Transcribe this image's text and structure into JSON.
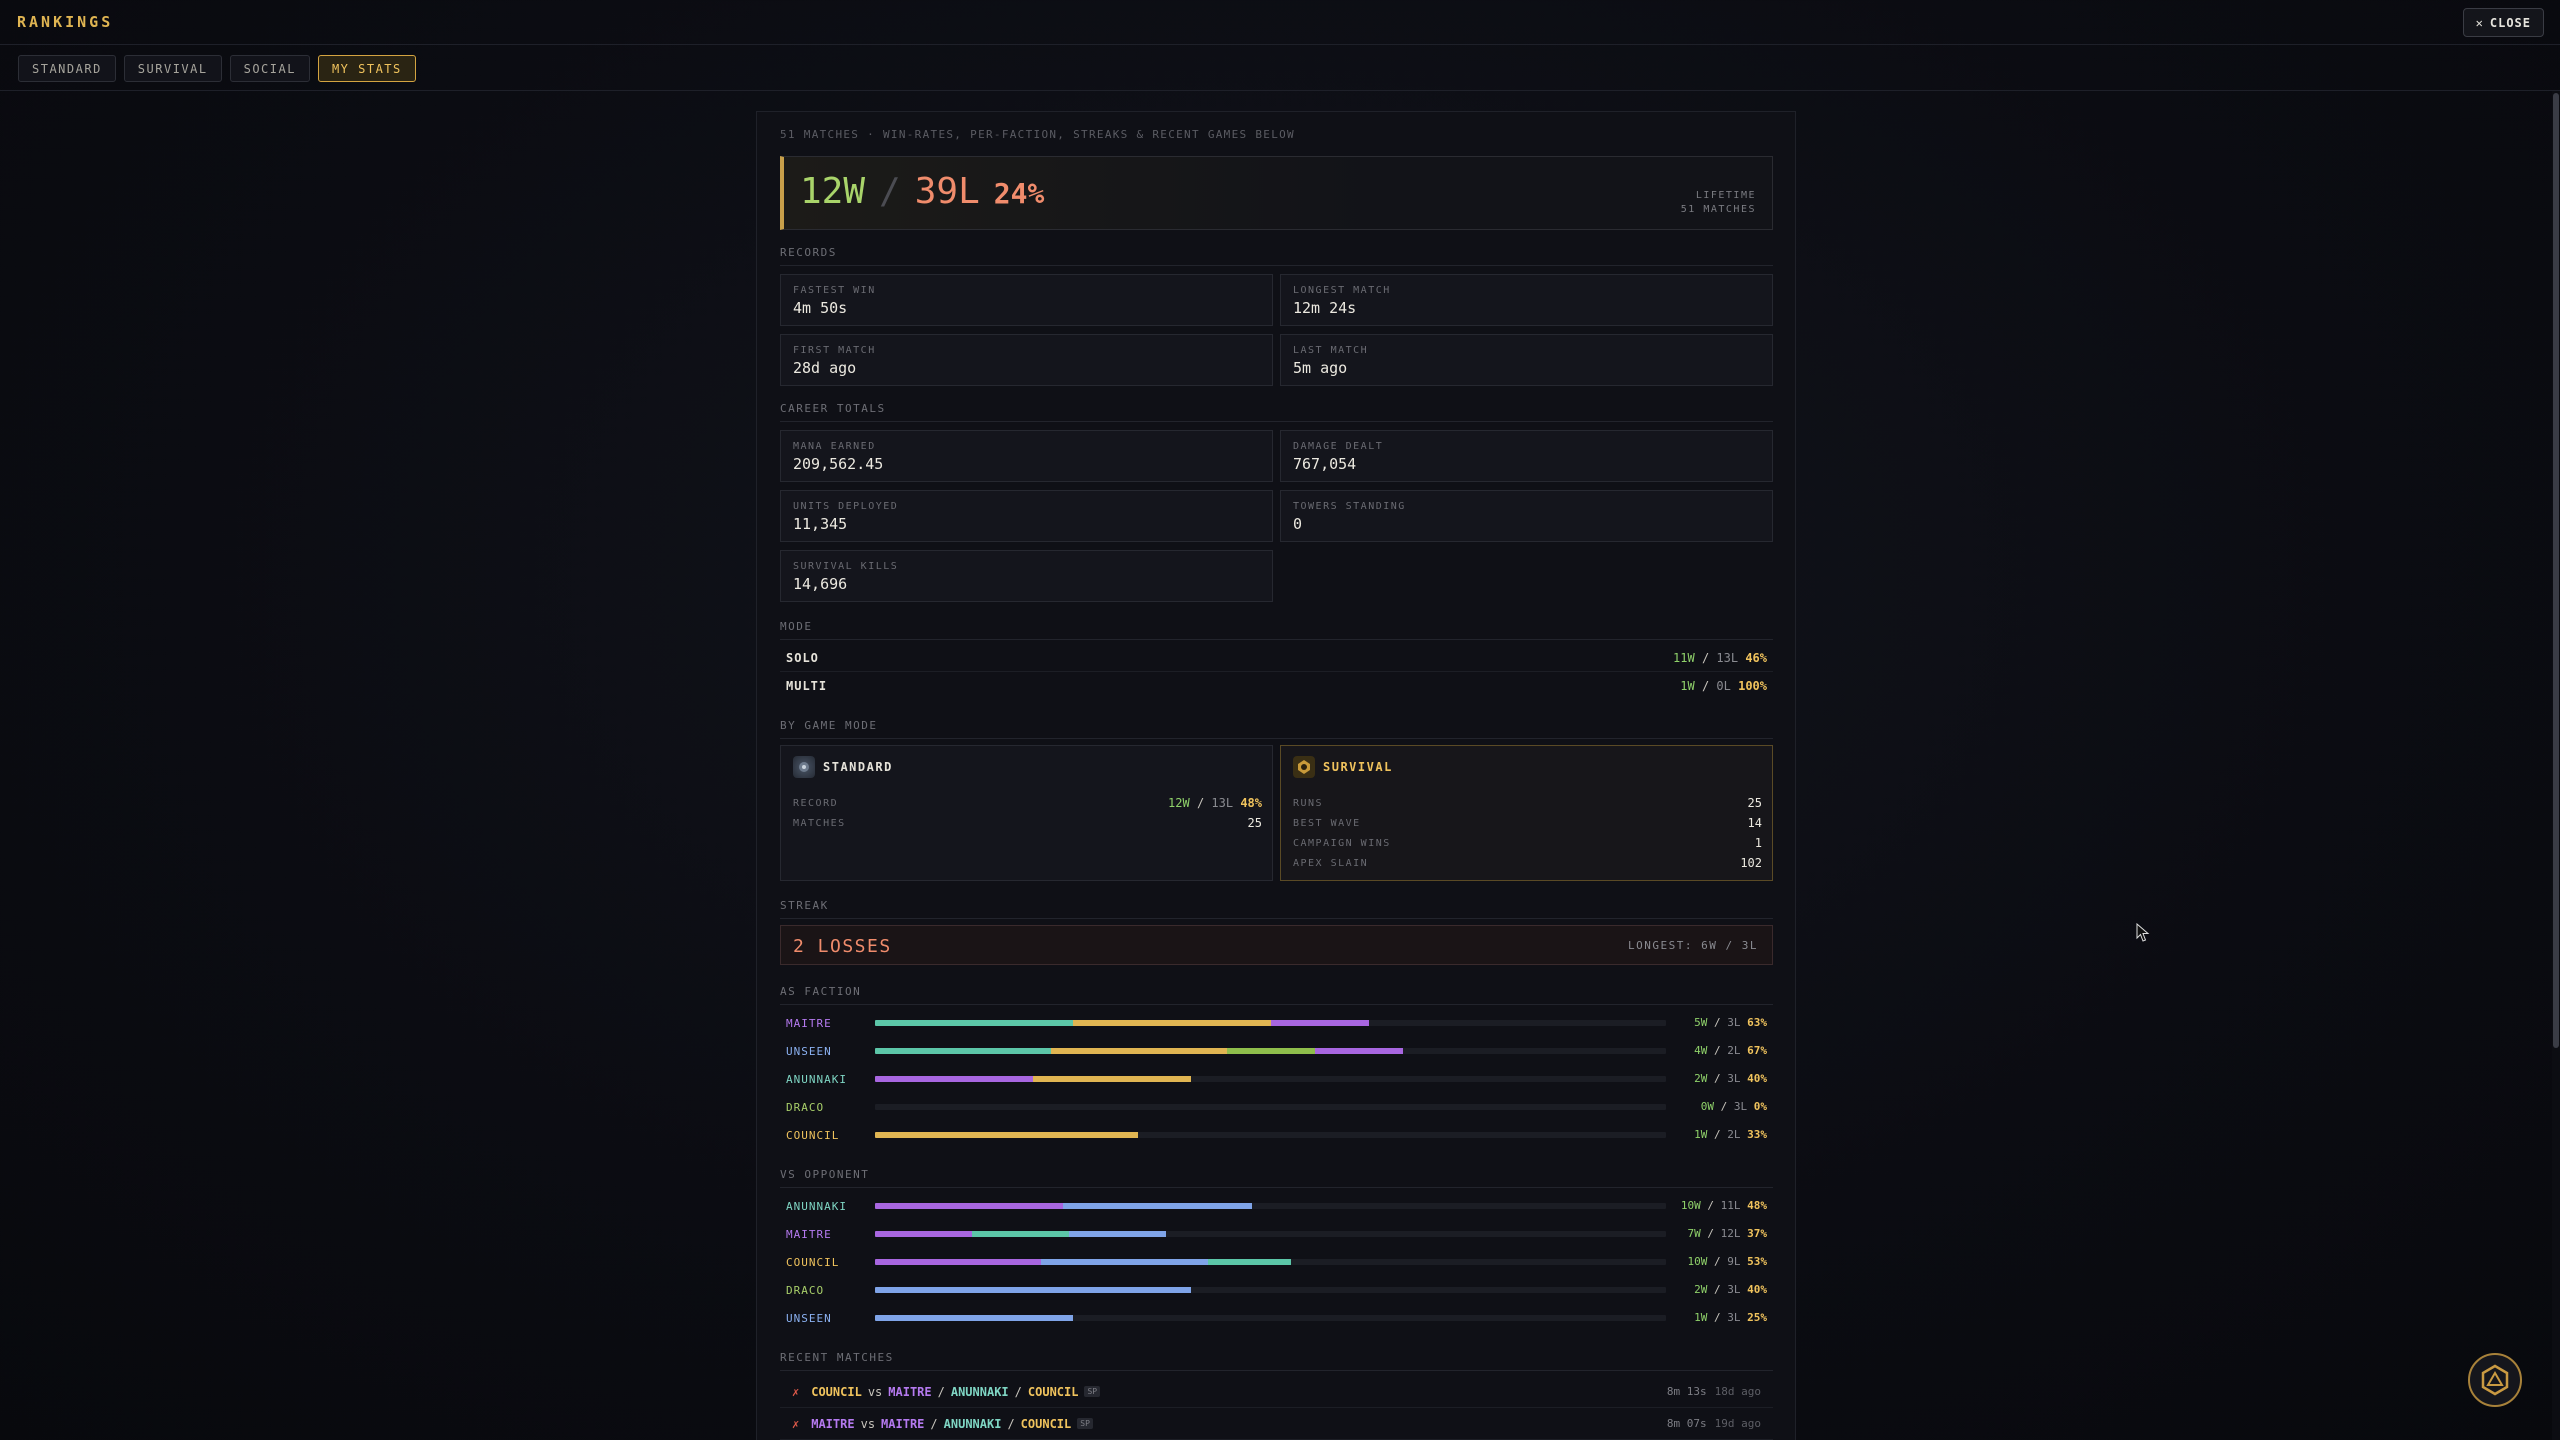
{
  "header": {
    "title": "RANKINGS",
    "close_label": "CLOSE"
  },
  "tabs": [
    {
      "label": "STANDARD",
      "active": false
    },
    {
      "label": "SURVIVAL",
      "active": false
    },
    {
      "label": "SOCIAL",
      "active": false
    },
    {
      "label": "MY STATS",
      "active": true
    }
  ],
  "summary": {
    "subtitle": "51 MATCHES · WIN-RATES, PER-FACTION, STREAKS & RECENT GAMES BELOW",
    "wins": "12W",
    "slash": "/",
    "losses": "39L",
    "pct": "24%",
    "meta_1": "LIFETIME",
    "meta_2": "51 MATCHES"
  },
  "records": {
    "label": "RECORDS",
    "items": [
      {
        "label": "FASTEST WIN",
        "value": "4m 50s"
      },
      {
        "label": "LONGEST MATCH",
        "value": "12m 24s"
      },
      {
        "label": "FIRST MATCH",
        "value": "28d ago"
      },
      {
        "label": "LAST MATCH",
        "value": "5m ago"
      }
    ]
  },
  "career": {
    "label": "CAREER TOTALS",
    "items": [
      {
        "label": "MANA EARNED",
        "value": "209,562.45"
      },
      {
        "label": "DAMAGE DEALT",
        "value": "767,054"
      },
      {
        "label": "UNITS DEPLOYED",
        "value": "11,345"
      },
      {
        "label": "TOWERS STANDING",
        "value": "0"
      },
      {
        "label": "SURVIVAL KILLS",
        "value": "14,696"
      }
    ]
  },
  "mode": {
    "label": "MODE",
    "rows": [
      {
        "name": "SOLO",
        "w": "11W",
        "l": "13L",
        "pct": "46%"
      },
      {
        "name": "MULTI",
        "w": "1W",
        "l": "0L",
        "pct": "100%"
      }
    ]
  },
  "game_mode": {
    "label": "BY GAME MODE",
    "standard": {
      "title": "STANDARD",
      "record_label": "RECORD",
      "w": "12W",
      "l": "13L",
      "pct": "48%",
      "matches_label": "MATCHES",
      "matches": "25"
    },
    "survival": {
      "title": "SURVIVAL",
      "stats": [
        {
          "label": "RUNS",
          "value": "25"
        },
        {
          "label": "BEST WAVE",
          "value": "14"
        },
        {
          "label": "CAMPAIGN WINS",
          "value": "1"
        },
        {
          "label": "APEX SLAIN",
          "value": "102"
        }
      ]
    }
  },
  "streak": {
    "label": "STREAK",
    "current": "2 LOSSES",
    "longest": "LONGEST: 6W / 3L"
  },
  "colors": {
    "maitre": "#b57af0",
    "unseen": "#8ab0f0",
    "anunnaki": "#7fd6c4",
    "draco": "#a8cf6a",
    "council": "#f0c35d",
    "accent": "#e0b552"
  },
  "as_faction": {
    "label": "AS FACTION",
    "rows": [
      {
        "name": "MAITRE",
        "color": "maitre",
        "w": "5W",
        "l": "3L",
        "pct": "63%",
        "win_rate": 0.625,
        "segments": [
          {
            "c": "#5cc6a8",
            "v": 2
          },
          {
            "c": "#e0b552",
            "v": 2
          },
          {
            "c": "#a866e0",
            "v": 1
          }
        ]
      },
      {
        "name": "UNSEEN",
        "color": "unseen",
        "w": "4W",
        "l": "2L",
        "pct": "67%",
        "win_rate": 0.667,
        "segments": [
          {
            "c": "#5cc6a8",
            "v": 1
          },
          {
            "c": "#e0b552",
            "v": 1
          },
          {
            "c": "#8fbe4c",
            "v": 0.5
          },
          {
            "c": "#a866e0",
            "v": 0.5
          }
        ]
      },
      {
        "name": "ANUNNAKI",
        "color": "anunnaki",
        "w": "2W",
        "l": "3L",
        "pct": "40%",
        "win_rate": 0.4,
        "segments": [
          {
            "c": "#a866e0",
            "v": 1
          },
          {
            "c": "#e0b552",
            "v": 1
          }
        ]
      },
      {
        "name": "DRACO",
        "color": "draco",
        "w": "0W",
        "l": "3L",
        "pct": "0%",
        "win_rate": 0,
        "segments": []
      },
      {
        "name": "COUNCIL",
        "color": "council",
        "w": "1W",
        "l": "2L",
        "pct": "33%",
        "win_rate": 0.333,
        "segments": [
          {
            "c": "#e0b552",
            "v": 1
          }
        ]
      }
    ]
  },
  "vs_opponent": {
    "label": "VS OPPONENT",
    "rows": [
      {
        "name": "ANUNNAKI",
        "color": "anunnaki",
        "w": "10W",
        "l": "11L",
        "pct": "48%",
        "win_rate": 0.476,
        "segments": [
          {
            "c": "#a866e0",
            "v": 1
          },
          {
            "c": "#7fa4e8",
            "v": 1
          }
        ]
      },
      {
        "name": "MAITRE",
        "color": "maitre",
        "w": "7W",
        "l": "12L",
        "pct": "37%",
        "win_rate": 0.368,
        "segments": [
          {
            "c": "#a866e0",
            "v": 1
          },
          {
            "c": "#5cc6a8",
            "v": 1
          },
          {
            "c": "#7fa4e8",
            "v": 1
          }
        ]
      },
      {
        "name": "COUNCIL",
        "color": "council",
        "w": "10W",
        "l": "9L",
        "pct": "53%",
        "win_rate": 0.526,
        "segments": [
          {
            "c": "#a866e0",
            "v": 2
          },
          {
            "c": "#7fa4e8",
            "v": 2
          },
          {
            "c": "#5cc6a8",
            "v": 1
          }
        ]
      },
      {
        "name": "DRACO",
        "color": "draco",
        "w": "2W",
        "l": "3L",
        "pct": "40%",
        "win_rate": 0.4,
        "segments": [
          {
            "c": "#7fa4e8",
            "v": 1
          }
        ]
      },
      {
        "name": "UNSEEN",
        "color": "unseen",
        "w": "1W",
        "l": "3L",
        "pct": "25%",
        "win_rate": 0.25,
        "segments": [
          {
            "c": "#7fa4e8",
            "v": 1
          }
        ]
      }
    ]
  },
  "recent": {
    "label": "RECENT MATCHES",
    "matches": [
      {
        "result": "✗",
        "self": "COUNCIL",
        "self_color": "council",
        "vs": "vs",
        "opp": [
          {
            "n": "MAITRE",
            "c": "maitre"
          },
          {
            "n": "ANUNNAKI",
            "c": "anunnaki"
          },
          {
            "n": "COUNCIL",
            "c": "council"
          }
        ],
        "tag": "SP",
        "duration": "8m 13s",
        "ago": "18d ago"
      },
      {
        "result": "✗",
        "self": "MAITRE",
        "self_color": "maitre",
        "vs": "vs",
        "opp": [
          {
            "n": "MAITRE",
            "c": "maitre"
          },
          {
            "n": "ANUNNAKI",
            "c": "anunnaki"
          },
          {
            "n": "COUNCIL",
            "c": "council"
          }
        ],
        "tag": "SP",
        "duration": "8m 07s",
        "ago": "19d ago"
      }
    ]
  }
}
